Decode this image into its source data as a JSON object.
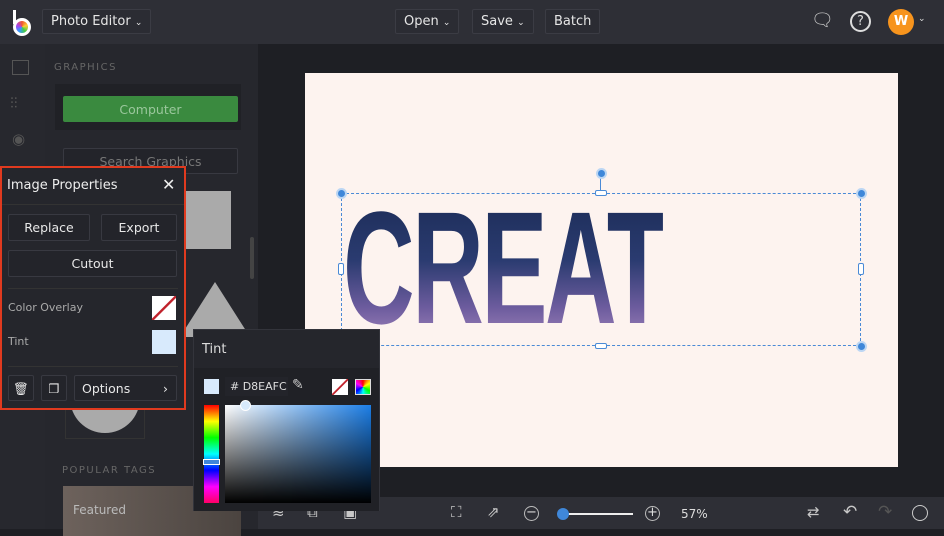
{
  "topbar": {
    "app_menu": "Photo Editor",
    "open": "Open",
    "save": "Save",
    "batch": "Batch",
    "avatar": "W"
  },
  "panel": {
    "section": "GRAPHICS",
    "computer": "Computer",
    "search": "Search Graphics",
    "popular_tags": "POPULAR TAGS",
    "tag_featured": "Featured"
  },
  "image_properties": {
    "title": "Image Properties",
    "replace": "Replace",
    "export": "Export",
    "cutout": "Cutout",
    "color_overlay": "Color Overlay",
    "tint": "Tint",
    "options": "Options"
  },
  "tint_popup": {
    "title": "Tint",
    "hex": "# D8EAFC",
    "color": "#D8EAFC"
  },
  "canvas": {
    "text": "CREATIVE"
  },
  "bottombar": {
    "zoom": "57%",
    "zoom_value": 57
  },
  "colors": {
    "accent": "#3f87d9",
    "green": "#3a8a3f",
    "highlight": "#e03a1f",
    "avatar": "#f7941d"
  }
}
